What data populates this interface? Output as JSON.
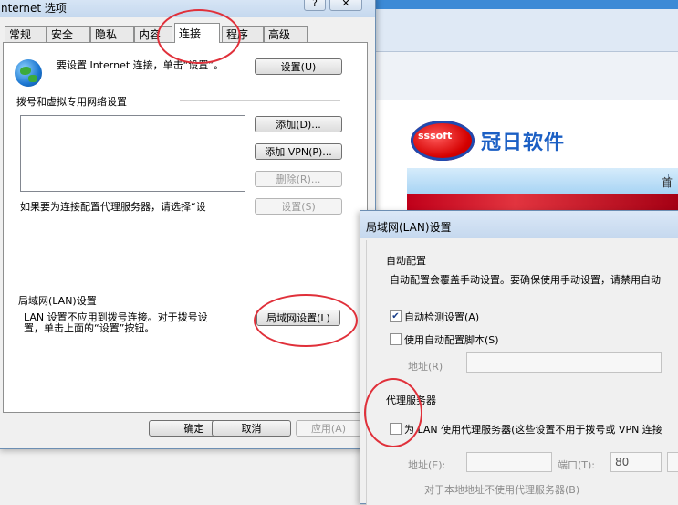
{
  "background_site": {
    "logo_text": "sssoft",
    "brand_name": "冠日软件",
    "nav_first": "首"
  },
  "internet_options": {
    "title": "nternet 选项",
    "tabs": [
      "常规",
      "安全",
      "隐私",
      "内容",
      "连接",
      "程序",
      "高级"
    ],
    "active_tab": "连接",
    "setup_text": "要设置 Internet 连接，单击“设置”。",
    "setup_button": "设置(U)",
    "dialup_group": "拨号和虚拟专用网络设置",
    "add_button": "添加(D)...",
    "add_vpn_button": "添加 VPN(P)...",
    "remove_button": "删除(R)...",
    "proxy_hint": "如果要为连接配置代理服务器，请选择“设",
    "settings_button": "设置(S)",
    "lan_group": "局域网(LAN)设置",
    "lan_text_line1": "LAN 设置不应用到拨号连接。对于拨号设",
    "lan_text_line2": "置，单击上面的“设置”按钮。",
    "lan_settings_button": "局域网设置(L)",
    "ok_button": "确定",
    "cancel_button": "取消",
    "apply_button": "应用(A)"
  },
  "lan_settings": {
    "title": "局域网(LAN)设置",
    "auto_config_group": "自动配置",
    "auto_config_desc": "自动配置会覆盖手动设置。要确保使用手动设置，请禁用自动",
    "auto_detect_label": "自动检测设置(A)",
    "auto_detect_checked": true,
    "auto_script_label": "使用自动配置脚本(S)",
    "auto_script_checked": false,
    "address_label": "地址(R)",
    "proxy_group": "代理服务器",
    "use_proxy_label": "为 LAN 使用代理服务器(这些设置不用于拨号或 VPN 连接",
    "use_proxy_checked": false,
    "proxy_address_label": "地址(E):",
    "proxy_port_label": "端口(T):",
    "proxy_port_value": "80",
    "bypass_label": "对于本地地址不使用代理服务器(B)"
  },
  "colors": {
    "highlight_ring": "#e0303a",
    "brand_blue": "#1b5fc4",
    "logo_red": "#d40000"
  }
}
